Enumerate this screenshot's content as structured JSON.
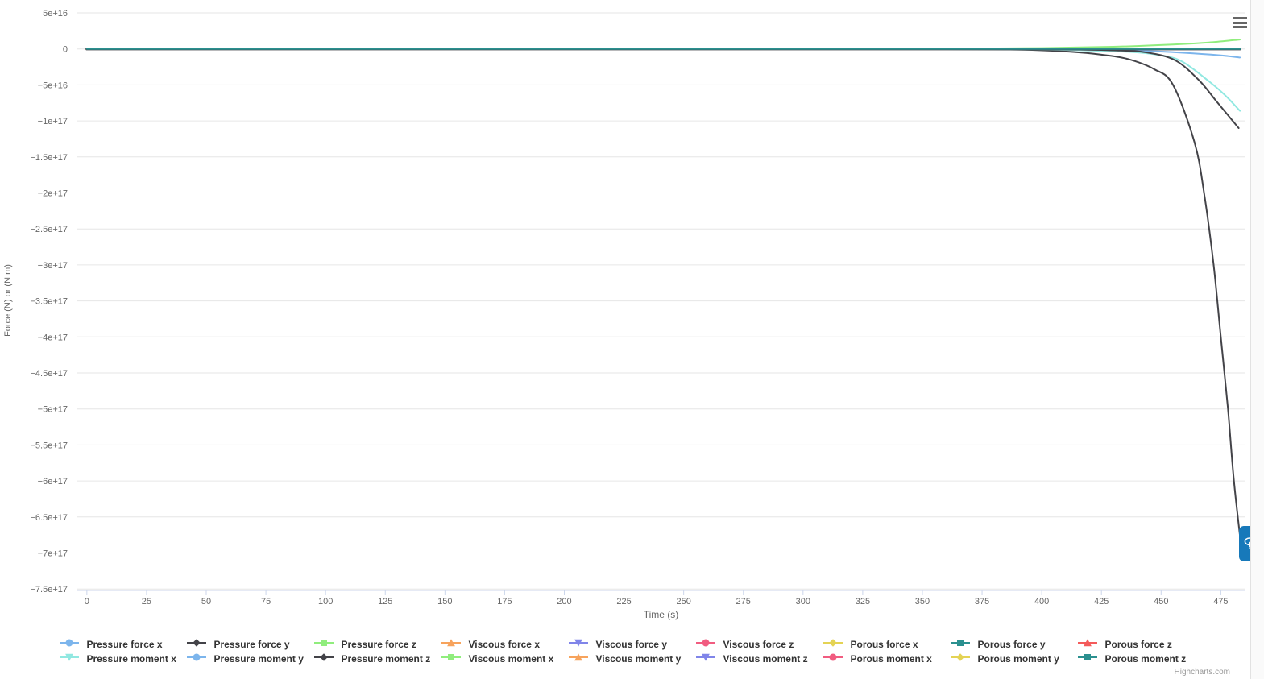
{
  "page": {
    "credits_label": "Highcharts.com"
  },
  "ui": {
    "chat_button_color": "#1779ba",
    "menu_icon_color": "#666666",
    "icons": {
      "menu": "hamburger-icon",
      "chat": "chat-bubbles-icon"
    }
  },
  "chart_data": {
    "type": "line",
    "title": "",
    "xlabel": "Time (s)",
    "ylabel": "Force (N) or (N m)",
    "xlim": [
      -4,
      485
    ],
    "ylim": [
      -7.52e+17,
      5e+16
    ],
    "grid": true,
    "legend_position": "bottom",
    "x_ticks": [
      {
        "value": 0,
        "label": "0"
      },
      {
        "value": 25,
        "label": "25"
      },
      {
        "value": 50,
        "label": "50"
      },
      {
        "value": 75,
        "label": "75"
      },
      {
        "value": 100,
        "label": "100"
      },
      {
        "value": 125,
        "label": "125"
      },
      {
        "value": 150,
        "label": "150"
      },
      {
        "value": 175,
        "label": "175"
      },
      {
        "value": 200,
        "label": "200"
      },
      {
        "value": 225,
        "label": "225"
      },
      {
        "value": 250,
        "label": "250"
      },
      {
        "value": 275,
        "label": "275"
      },
      {
        "value": 300,
        "label": "300"
      },
      {
        "value": 325,
        "label": "325"
      },
      {
        "value": 350,
        "label": "350"
      },
      {
        "value": 375,
        "label": "375"
      },
      {
        "value": 400,
        "label": "400"
      },
      {
        "value": 425,
        "label": "425"
      },
      {
        "value": 450,
        "label": "450"
      },
      {
        "value": 475,
        "label": "475"
      }
    ],
    "y_ticks": [
      {
        "value": 5e+16,
        "label": "5e+16"
      },
      {
        "value": 0,
        "label": "0"
      },
      {
        "value": -5e+16,
        "label": "−5e+16"
      },
      {
        "value": -1e+17,
        "label": "−1e+17"
      },
      {
        "value": -1.5e+17,
        "label": "−1.5e+17"
      },
      {
        "value": -2e+17,
        "label": "−2e+17"
      },
      {
        "value": -2.5e+17,
        "label": "−2.5e+17"
      },
      {
        "value": -3e+17,
        "label": "−3e+17"
      },
      {
        "value": -3.5e+17,
        "label": "−3.5e+17"
      },
      {
        "value": -4e+17,
        "label": "−4e+17"
      },
      {
        "value": -4.5e+17,
        "label": "−4.5e+17"
      },
      {
        "value": -5e+17,
        "label": "−5e+17"
      },
      {
        "value": -5.5e+17,
        "label": "−5.5e+17"
      },
      {
        "value": -6e+17,
        "label": "−6e+17"
      },
      {
        "value": -6.5e+17,
        "label": "−6.5e+17"
      },
      {
        "value": -7e+17,
        "label": "−7e+17"
      },
      {
        "value": -7.5e+17,
        "label": "−7.5e+17"
      }
    ],
    "series": [
      {
        "name": "Pressure force x",
        "color": "#7cb5ec",
        "marker": "circle",
        "points": [
          [
            0,
            0
          ],
          [
            100,
            0
          ],
          [
            200,
            0
          ],
          [
            300,
            0
          ],
          [
            360,
            0
          ],
          [
            410,
            -800000000000000.0
          ],
          [
            440,
            -2500000000000000.0
          ],
          [
            460,
            -5500000000000000.0
          ],
          [
            475,
            -9000000000000000.0
          ],
          [
            483,
            -1.2e+16
          ]
        ]
      },
      {
        "name": "Pressure force y",
        "color": "#434348",
        "marker": "diamond",
        "points": [
          [
            0,
            0
          ],
          [
            100,
            0
          ],
          [
            200,
            0
          ],
          [
            300,
            0
          ],
          [
            350,
            -200000000000000.0
          ],
          [
            380,
            -700000000000000.0
          ],
          [
            396,
            -1500000000000000.0
          ],
          [
            412,
            -4000000000000000.0
          ],
          [
            425,
            -8000000000000000.0
          ],
          [
            436,
            -1.4e+16
          ],
          [
            447,
            -2.8e+16
          ],
          [
            455,
            -5e+16
          ],
          [
            464,
            -1.3e+17
          ],
          [
            468,
            -2e+17
          ],
          [
            472,
            -3e+17
          ],
          [
            475,
            -4e+17
          ],
          [
            478,
            -5e+17
          ],
          [
            480.5,
            -6e+17
          ],
          [
            483.5,
            -6.9e+17
          ]
        ]
      },
      {
        "name": "Pressure force z",
        "color": "#90ed7d",
        "marker": "square",
        "points": [
          [
            0,
            0
          ],
          [
            100,
            0
          ],
          [
            200,
            0
          ],
          [
            300,
            0
          ],
          [
            360,
            200000000000000.0
          ],
          [
            400,
            1200000000000000.0
          ],
          [
            430,
            3000000000000000.0
          ],
          [
            455,
            6000000000000000.0
          ],
          [
            470,
            9000000000000000.0
          ],
          [
            483,
            1.3e+16
          ]
        ]
      },
      {
        "name": "Viscous force x",
        "color": "#f7a35c",
        "marker": "triangle",
        "points": [
          [
            0,
            0
          ],
          [
            483,
            0
          ]
        ]
      },
      {
        "name": "Viscous force y",
        "color": "#8085e9",
        "marker": "triangle-down",
        "points": [
          [
            0,
            0
          ],
          [
            483,
            0
          ]
        ]
      },
      {
        "name": "Viscous force z",
        "color": "#f15c80",
        "marker": "circle",
        "points": [
          [
            0,
            0
          ],
          [
            483,
            0
          ]
        ]
      },
      {
        "name": "Porous force x",
        "color": "#e4d354",
        "marker": "diamond",
        "points": [
          [
            0,
            0
          ],
          [
            483,
            0
          ]
        ]
      },
      {
        "name": "Porous force y",
        "color": "#2b908f",
        "marker": "square",
        "points": [
          [
            0,
            0
          ],
          [
            483,
            0
          ]
        ]
      },
      {
        "name": "Porous force z",
        "color": "#f45b5b",
        "marker": "triangle",
        "points": [
          [
            0,
            0
          ],
          [
            483,
            0
          ]
        ]
      },
      {
        "name": "Pressure moment x",
        "color": "#91e8e1",
        "marker": "triangle-down",
        "points": [
          [
            0,
            0
          ],
          [
            100,
            0
          ],
          [
            200,
            0
          ],
          [
            300,
            0
          ],
          [
            380,
            -500000000000000.0
          ],
          [
            410,
            -1500000000000000.0
          ],
          [
            436,
            -4000000000000000.0
          ],
          [
            450,
            -9000000000000000.0
          ],
          [
            459,
            -1.8e+16
          ],
          [
            470,
            -4.5e+16
          ],
          [
            477,
            -6.5e+16
          ],
          [
            483,
            -8.6e+16
          ]
        ]
      },
      {
        "name": "Pressure moment y",
        "color": "#7cb5ec",
        "marker": "circle",
        "points": [
          [
            0,
            0
          ],
          [
            483,
            0
          ]
        ]
      },
      {
        "name": "Pressure moment z",
        "color": "#434348",
        "marker": "diamond",
        "points": [
          [
            0,
            0
          ],
          [
            100,
            0
          ],
          [
            200,
            0
          ],
          [
            300,
            0
          ],
          [
            400,
            -500000000000000.0
          ],
          [
            430,
            -2000000000000000.0
          ],
          [
            444,
            -5000000000000000.0
          ],
          [
            456,
            -1.6e+16
          ],
          [
            466,
            -4.4e+16
          ],
          [
            473,
            -7.2e+16
          ],
          [
            482.5,
            -1.1e+17
          ]
        ]
      },
      {
        "name": "Viscous moment x",
        "color": "#90ed7d",
        "marker": "square",
        "points": [
          [
            0,
            0
          ],
          [
            483,
            0
          ]
        ]
      },
      {
        "name": "Viscous moment y",
        "color": "#f7a35c",
        "marker": "triangle",
        "points": [
          [
            0,
            0
          ],
          [
            483,
            0
          ]
        ]
      },
      {
        "name": "Viscous moment z",
        "color": "#8085e9",
        "marker": "triangle-down",
        "points": [
          [
            0,
            0
          ],
          [
            483,
            0
          ]
        ]
      },
      {
        "name": "Porous moment x",
        "color": "#f15c80",
        "marker": "circle",
        "points": [
          [
            0,
            0
          ],
          [
            483,
            0
          ]
        ]
      },
      {
        "name": "Porous moment y",
        "color": "#e4d354",
        "marker": "diamond",
        "points": [
          [
            0,
            0
          ],
          [
            483,
            0
          ]
        ]
      },
      {
        "name": "Porous moment z",
        "color": "#2b908f",
        "marker": "square",
        "points": [
          [
            0,
            0
          ],
          [
            483,
            0
          ]
        ]
      }
    ]
  }
}
